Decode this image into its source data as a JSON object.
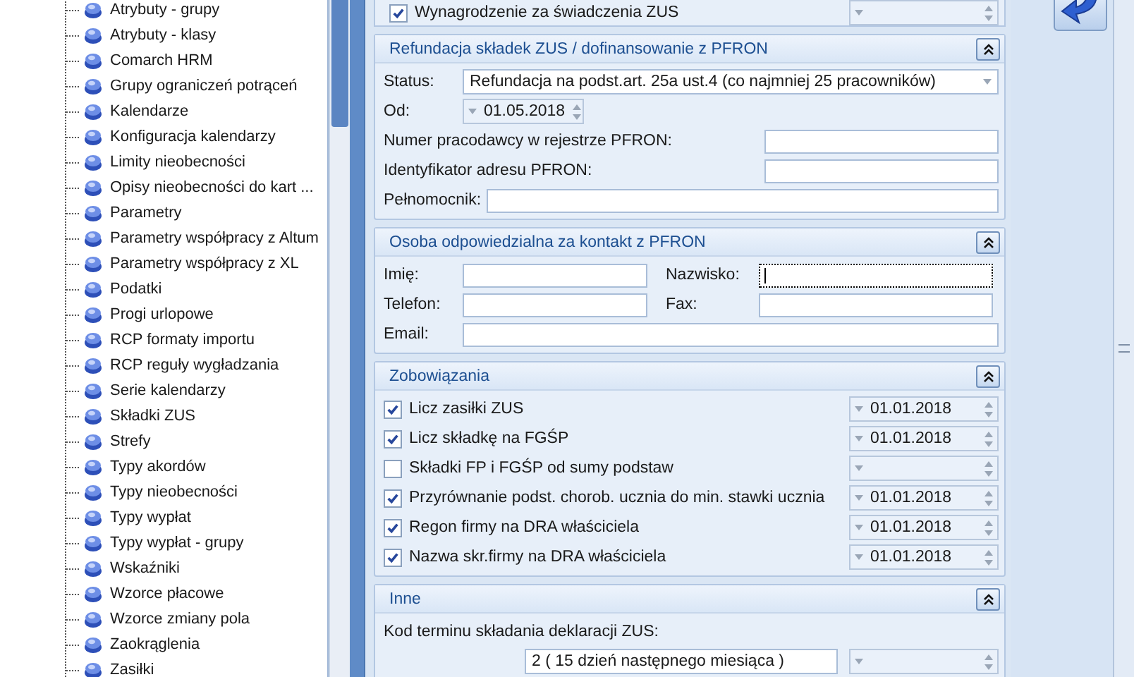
{
  "tree": {
    "items": [
      "Atrybuty - grupy",
      "Atrybuty - klasy",
      "Comarch HRM",
      "Grupy ograniczeń potrąceń",
      "Kalendarze",
      "Konfiguracja kalendarzy",
      "Limity nieobecności",
      "Opisy nieobecności do kart ...",
      "Parametry",
      "Parametry współpracy z Altum",
      "Parametry współpracy z XL",
      "Podatki",
      "Progi urlopowe",
      "RCP formaty importu",
      "RCP reguły wygładzania",
      "Serie kalendarzy",
      "Składki ZUS",
      "Strefy",
      "Typy akordów",
      "Typy nieobecności",
      "Typy wypłat",
      "Typy wypłat - grupy",
      "Wskaźniki",
      "Wzorce płacowe",
      "Wzorce zmiany pola",
      "Zaokrąglenia",
      "Zasiłki"
    ]
  },
  "top_option": {
    "label": "Wynagrodzenie za świadczenia ZUS",
    "checked": true
  },
  "sections": [
    {
      "title": "Refundacja składek ZUS / dofinansowanie z PFRON",
      "expanded": true,
      "rows": [
        {
          "kind": "combo",
          "label": "Status:",
          "value": "Refundacja na podst.art. 25a ust.4 (co najmniej 25 pracowników)"
        },
        {
          "kind": "date",
          "label": "Od:",
          "value": "01.05.2018"
        },
        {
          "kind": "text",
          "label": "Numer pracodawcy w rejestrze PFRON:"
        },
        {
          "kind": "text",
          "label": "Identyfikator adresu PFRON:"
        },
        {
          "kind": "wide",
          "label": "Pełnomocnik:"
        }
      ]
    },
    {
      "title": "Osoba odpowiedzialna za kontakt z PFRON",
      "expanded": true,
      "rows": [
        {
          "kind": "pair",
          "fields": [
            {
              "label": "Imię:",
              "focused": false
            },
            {
              "label": "Nazwisko:",
              "focused": true
            }
          ]
        },
        {
          "kind": "pair",
          "fields": [
            {
              "label": "Telefon:",
              "focused": false
            },
            {
              "label": "Fax:",
              "focused": false
            }
          ]
        },
        {
          "kind": "email",
          "label": "Email:"
        }
      ]
    },
    {
      "title": "Zobowiązania",
      "expanded": true,
      "rows": [
        {
          "kind": "check",
          "label": "Licz zasiłki ZUS",
          "checked": true,
          "date": "01.01.2018"
        },
        {
          "kind": "check",
          "label": "Licz składkę na FGŚP",
          "checked": true,
          "date": "01.01.2018"
        },
        {
          "kind": "check",
          "label": "Składki FP i FGŚP od sumy podstaw",
          "checked": false
        },
        {
          "kind": "check",
          "label": "Przyrównanie podst. chorob. ucznia do min. stawki ucznia",
          "checked": true,
          "date": "01.01.2018"
        },
        {
          "kind": "check",
          "label": "Regon firmy na DRA właściciela",
          "checked": true,
          "date": "01.01.2018"
        },
        {
          "kind": "check",
          "label": "Nazwa skr.firmy na DRA właściciela",
          "checked": true,
          "date": "01.01.2018"
        }
      ]
    },
    {
      "title": "Inne",
      "expanded": true,
      "rows": [
        {
          "kind": "label",
          "label": "Kod terminu składania deklaracji ZUS:"
        },
        {
          "kind": "combospin",
          "value": "2 ( 15 dzień następnego miesiąca )"
        }
      ]
    }
  ]
}
